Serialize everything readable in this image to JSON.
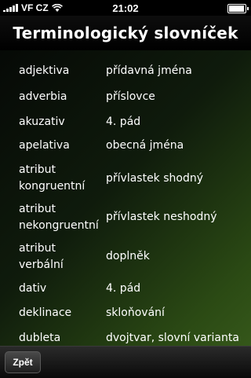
{
  "status": {
    "carrier": "VF CZ",
    "time": "21:02"
  },
  "header": {
    "title": "Terminologický slovníček"
  },
  "entries": [
    {
      "term": "adjektiva",
      "definition": "přídavná jména"
    },
    {
      "term": "adverbia",
      "definition": "příslovce"
    },
    {
      "term": "akuzativ",
      "definition": "4. pád"
    },
    {
      "term": "apelativa",
      "definition": "obecná jména"
    },
    {
      "term_line1": "atribut",
      "term_line2": "kongruentní",
      "definition": "přívlastek shodný"
    },
    {
      "term_line1": "atribut",
      "term_line2": "nekongruentní",
      "definition": "přívlastek neshodný"
    },
    {
      "term_line1": "atribut",
      "term_line2": "verbální",
      "definition": "doplněk"
    },
    {
      "term": "dativ",
      "definition": "4. pád"
    },
    {
      "term": "deklinace",
      "definition": "skloňování"
    },
    {
      "term": "dubleta",
      "definition": "dvojtvar, slovní varianta"
    }
  ],
  "toolbar": {
    "back_label": "Zpět"
  }
}
